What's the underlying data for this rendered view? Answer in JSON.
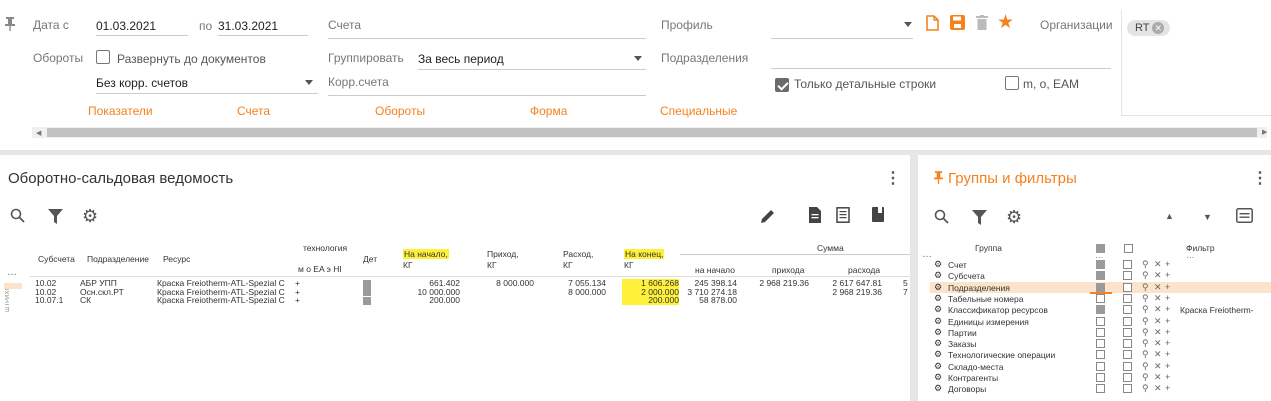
{
  "filters": {
    "date_from_label": "Дата с",
    "date_from": "01.03.2021",
    "date_to_label": "по",
    "date_to": "31.03.2021",
    "accounts_label": "Счета",
    "profile_label": "Профиль",
    "organizations_label": "Организации",
    "org_chip": "RT",
    "turnovers_label": "Обороты",
    "expand_docs_label": "Развернуть до документов",
    "group_label": "Группировать",
    "group_value": "За весь период",
    "divisions_label": "Подразделения",
    "corr_select": "Без корр. счетов",
    "corr_account_label": "Корр.счета",
    "detail_only_label": "Только детальные строки",
    "meo_label": "m, o, EAM"
  },
  "tabs": [
    "Показатели",
    "Счета",
    "Обороты",
    "Форма",
    "Специальные"
  ],
  "report": {
    "title": "Оборотно-сальдовая ведомость",
    "columns": {
      "subaccount": "Субсчета",
      "division": "Подразделение",
      "resource": "Ресурс",
      "tech": "технология",
      "tech_sub": "м  о  EA  э  HI",
      "det": "Дет",
      "start": "На начало,",
      "start_unit": "КГ",
      "income": "Приход,",
      "income_unit": "КГ",
      "expense": "Расход,",
      "expense_unit": "КГ",
      "end": "На конец,",
      "end_unit": "КГ",
      "sum": "Сумма",
      "sum_start": "на начало",
      "sum_income": "прихода",
      "sum_expense": "расхода"
    },
    "side_label": "ШТРИХК",
    "rows": [
      {
        "sub": "10.02",
        "div": "АБР УПП",
        "res": "Краска Freiotherm-ATL-Spezial C",
        "plus": "+",
        "start": "661.402",
        "income": "8 000.000",
        "expense": "7 055.134",
        "end": "1 606.268",
        "s_start": "245 398.14",
        "s_income": "2 968 219.36",
        "s_expense": "2 617 647.81",
        "tail": "5"
      },
      {
        "sub": "10.02",
        "div": "Осн.скл.РТ",
        "res": "Краска Freiotherm-ATL-Spezial C",
        "plus": "+",
        "start": "10 000.000",
        "income": "",
        "expense": "8 000.000",
        "end": "2 000.000",
        "s_start": "3 710 274.18",
        "s_income": "",
        "s_expense": "2 968 219.36",
        "tail": "7"
      },
      {
        "sub": "10.07.1",
        "div": "СК",
        "res": "Краска Freiotherm-ATL-Spezial C",
        "plus": "+",
        "start": "200.000",
        "income": "",
        "expense": "",
        "end": "200.000",
        "s_start": "58 878.00",
        "s_income": "",
        "s_expense": "",
        "tail": ""
      }
    ]
  },
  "groups": {
    "title": "Группы и фильтры",
    "col_group": "Группа",
    "col_filter": "Фильтр",
    "items": [
      {
        "name": "Счет",
        "c1": true,
        "filter": ""
      },
      {
        "name": "Субсчета",
        "c1": true,
        "filter": ""
      },
      {
        "name": "Подразделения",
        "c1": true,
        "filter": "",
        "selected": true
      },
      {
        "name": "Табельные номера",
        "c1": false,
        "filter": ""
      },
      {
        "name": "Классификатор ресурсов",
        "c1": true,
        "filter": "Краска Freiotherm-"
      },
      {
        "name": "Единицы измерения",
        "c1": false,
        "filter": ""
      },
      {
        "name": "Партии",
        "c1": false,
        "filter": ""
      },
      {
        "name": "Заказы",
        "c1": false,
        "filter": ""
      },
      {
        "name": "Технологические операции",
        "c1": false,
        "filter": ""
      },
      {
        "name": "Складо-места",
        "c1": false,
        "filter": ""
      },
      {
        "name": "Контрагенты",
        "c1": false,
        "filter": ""
      },
      {
        "name": "Договоры",
        "c1": false,
        "filter": ""
      }
    ]
  },
  "colors": {
    "accent": "#f5811f",
    "highlight": "#fff13a",
    "selected_row": "#fde3cb"
  }
}
